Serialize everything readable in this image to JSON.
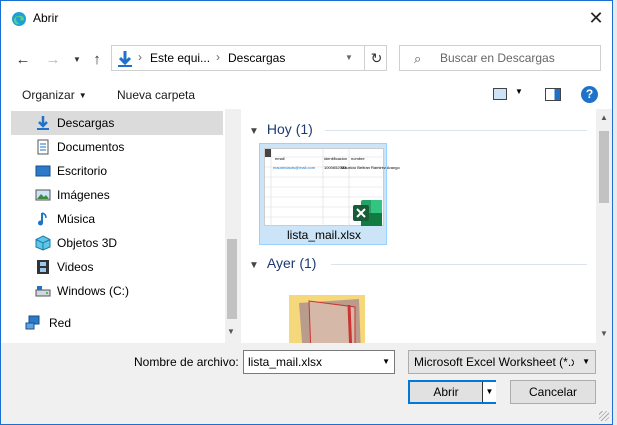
{
  "window": {
    "title": "Abrir",
    "accent": "#0078d7"
  },
  "address": {
    "crumbs": [
      "Este equi...",
      "Descargas"
    ]
  },
  "search": {
    "placeholder": "Buscar en Descargas"
  },
  "toolbar": {
    "organize": "Organizar",
    "new_folder": "Nueva carpeta",
    "help": "?"
  },
  "sidebar": {
    "items": [
      {
        "label": "Descargas",
        "icon": "download-arrow-icon"
      },
      {
        "label": "Documentos",
        "icon": "document-icon"
      },
      {
        "label": "Escritorio",
        "icon": "desktop-icon"
      },
      {
        "label": "Imágenes",
        "icon": "picture-icon"
      },
      {
        "label": "Música",
        "icon": "music-note-icon"
      },
      {
        "label": "Objetos 3D",
        "icon": "cube-icon"
      },
      {
        "label": "Videos",
        "icon": "film-icon"
      },
      {
        "label": "Windows (C:)",
        "icon": "drive-icon"
      },
      {
        "label": "Red",
        "icon": "network-icon"
      }
    ],
    "selected": "Descargas"
  },
  "content": {
    "groups": [
      {
        "label": "Hoy (1)"
      },
      {
        "label": "Ayer (1)"
      }
    ],
    "file": {
      "name": "lista_mail.xlsx",
      "thumb_headers": [
        "email",
        "identificacion",
        "nombre"
      ],
      "thumb_row": [
        "mauriedauts@mail.com",
        "1000652003",
        "Mauricio Beltran Ramirez Arango"
      ]
    }
  },
  "footer": {
    "filename_label": "Nombre de archivo:",
    "filename_value": "lista_mail.xlsx",
    "filter_value": "Microsoft Excel Worksheet (*.xl",
    "open_label": "Abrir",
    "cancel_label": "Cancelar"
  }
}
